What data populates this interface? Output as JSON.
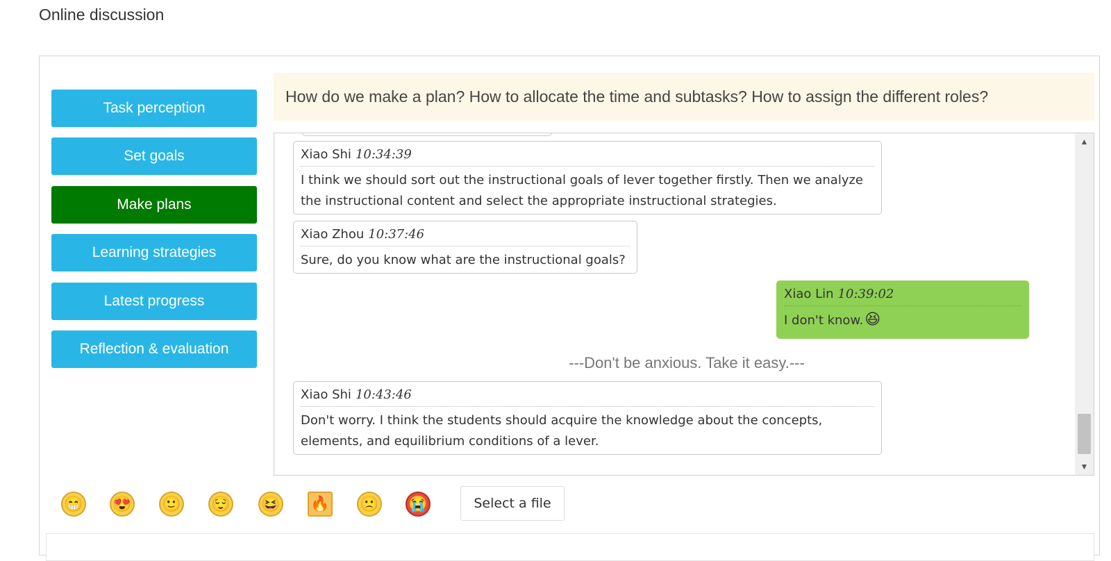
{
  "page_title": "Online discussion",
  "nav": {
    "items": [
      {
        "label": "Task perception",
        "active": false
      },
      {
        "label": "Set goals",
        "active": false
      },
      {
        "label": "Make plans",
        "active": true
      },
      {
        "label": "Learning strategies",
        "active": false
      },
      {
        "label": "Latest progress",
        "active": false
      },
      {
        "label": "Reflection & evaluation",
        "active": false
      }
    ],
    "colors": {
      "default": "#29b6e6",
      "active": "#007a00"
    }
  },
  "question": "How do we make a plan? How to allocate the time and subtasks? How to assign the different roles?",
  "chat": {
    "messages": [
      {
        "author": "Xiao Shi",
        "time": "10:34:39",
        "text": "I think we should sort out the instructional goals of lever together firstly. Then we analyze the instructional content and select the appropriate instructional strategies.",
        "mine": false
      },
      {
        "author": "Xiao Zhou",
        "time": "10:37:46",
        "text": "Sure, do you know what are the instructional goals?",
        "mine": false
      },
      {
        "author": "Xiao Lin",
        "time": "10:39:02",
        "text": "I don't know.",
        "mine": true,
        "emoji": "laughing-face-icon"
      },
      {
        "author": "Xiao Shi",
        "time": "10:43:46",
        "text": "Don't worry. I think the students should acquire the knowledge about the concepts, elements, and equilibrium conditions of a lever.",
        "mine": false
      }
    ],
    "system_note": "---Don't be anxious. Take it easy.---",
    "own_message_color": "#8fd154"
  },
  "toolbar": {
    "emojis": [
      "grinning-face-icon",
      "heart-eyes-face-icon",
      "smiling-face-icon",
      "relieved-face-icon",
      "laughing-face-icon",
      "angry-fire-icon",
      "sad-face-icon",
      "crying-face-icon"
    ],
    "file_button_label": "Select a file"
  },
  "input": {
    "placeholder": ""
  }
}
